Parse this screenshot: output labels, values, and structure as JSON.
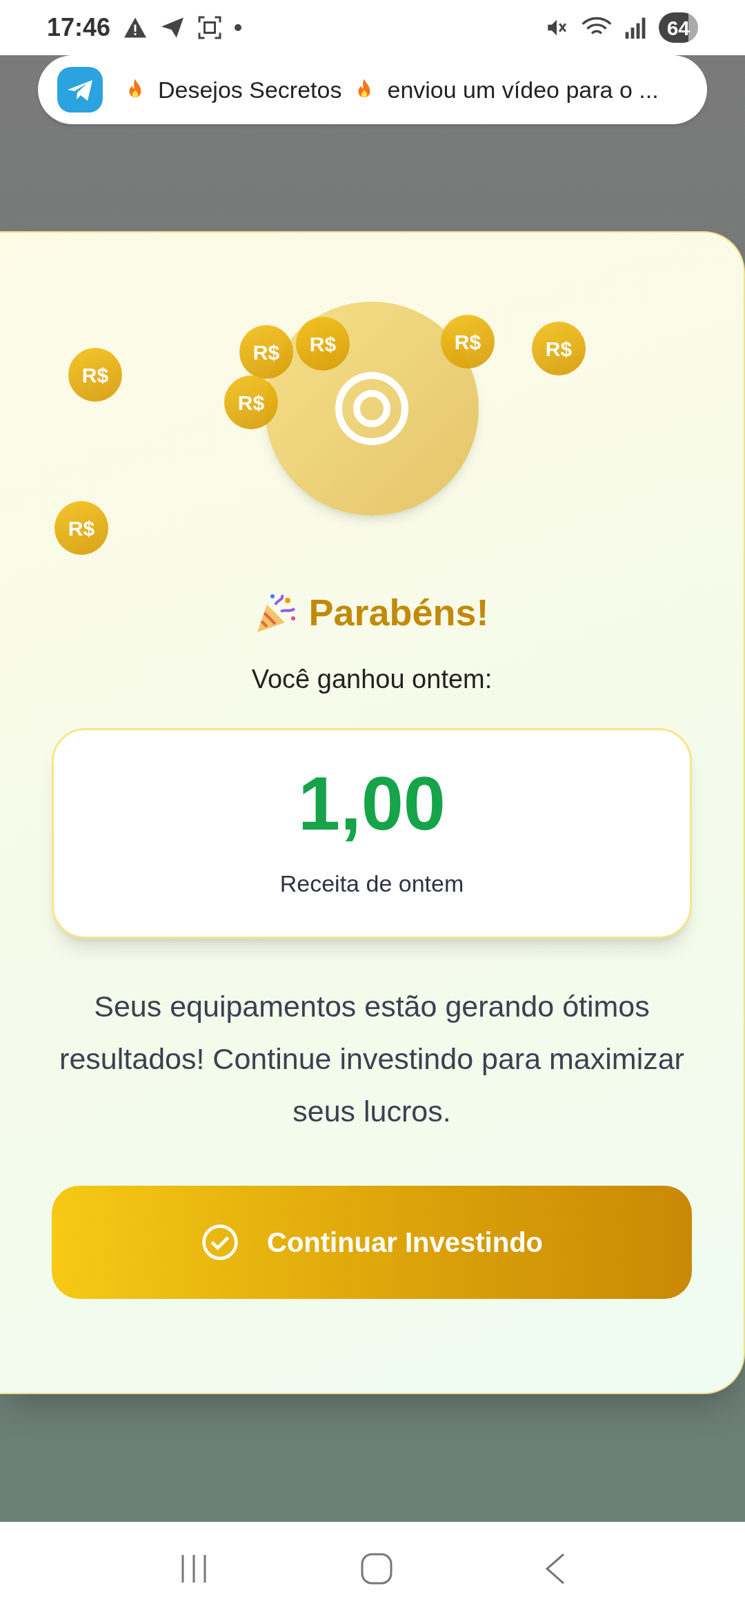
{
  "status_bar": {
    "time": "17:46",
    "battery": "64"
  },
  "notification": {
    "sender": "Desejos Secretos",
    "message": "enviou um vídeo para o ..."
  },
  "modal": {
    "coins": [
      {
        "label": "R$"
      },
      {
        "label": "R$"
      },
      {
        "label": "R$"
      },
      {
        "label": "R$"
      },
      {
        "label": "R$"
      },
      {
        "label": "R$"
      },
      {
        "label": "R$"
      }
    ],
    "title": "Parabéns!",
    "subtitle": "Você ganhou ontem:",
    "amount": "1,00",
    "amount_label": "Receita de ontem",
    "message": "Seus equipamentos estão gerando ótimos resultados! Continue investindo para maximizar seus lucros.",
    "button": "Continuar Investindo"
  }
}
